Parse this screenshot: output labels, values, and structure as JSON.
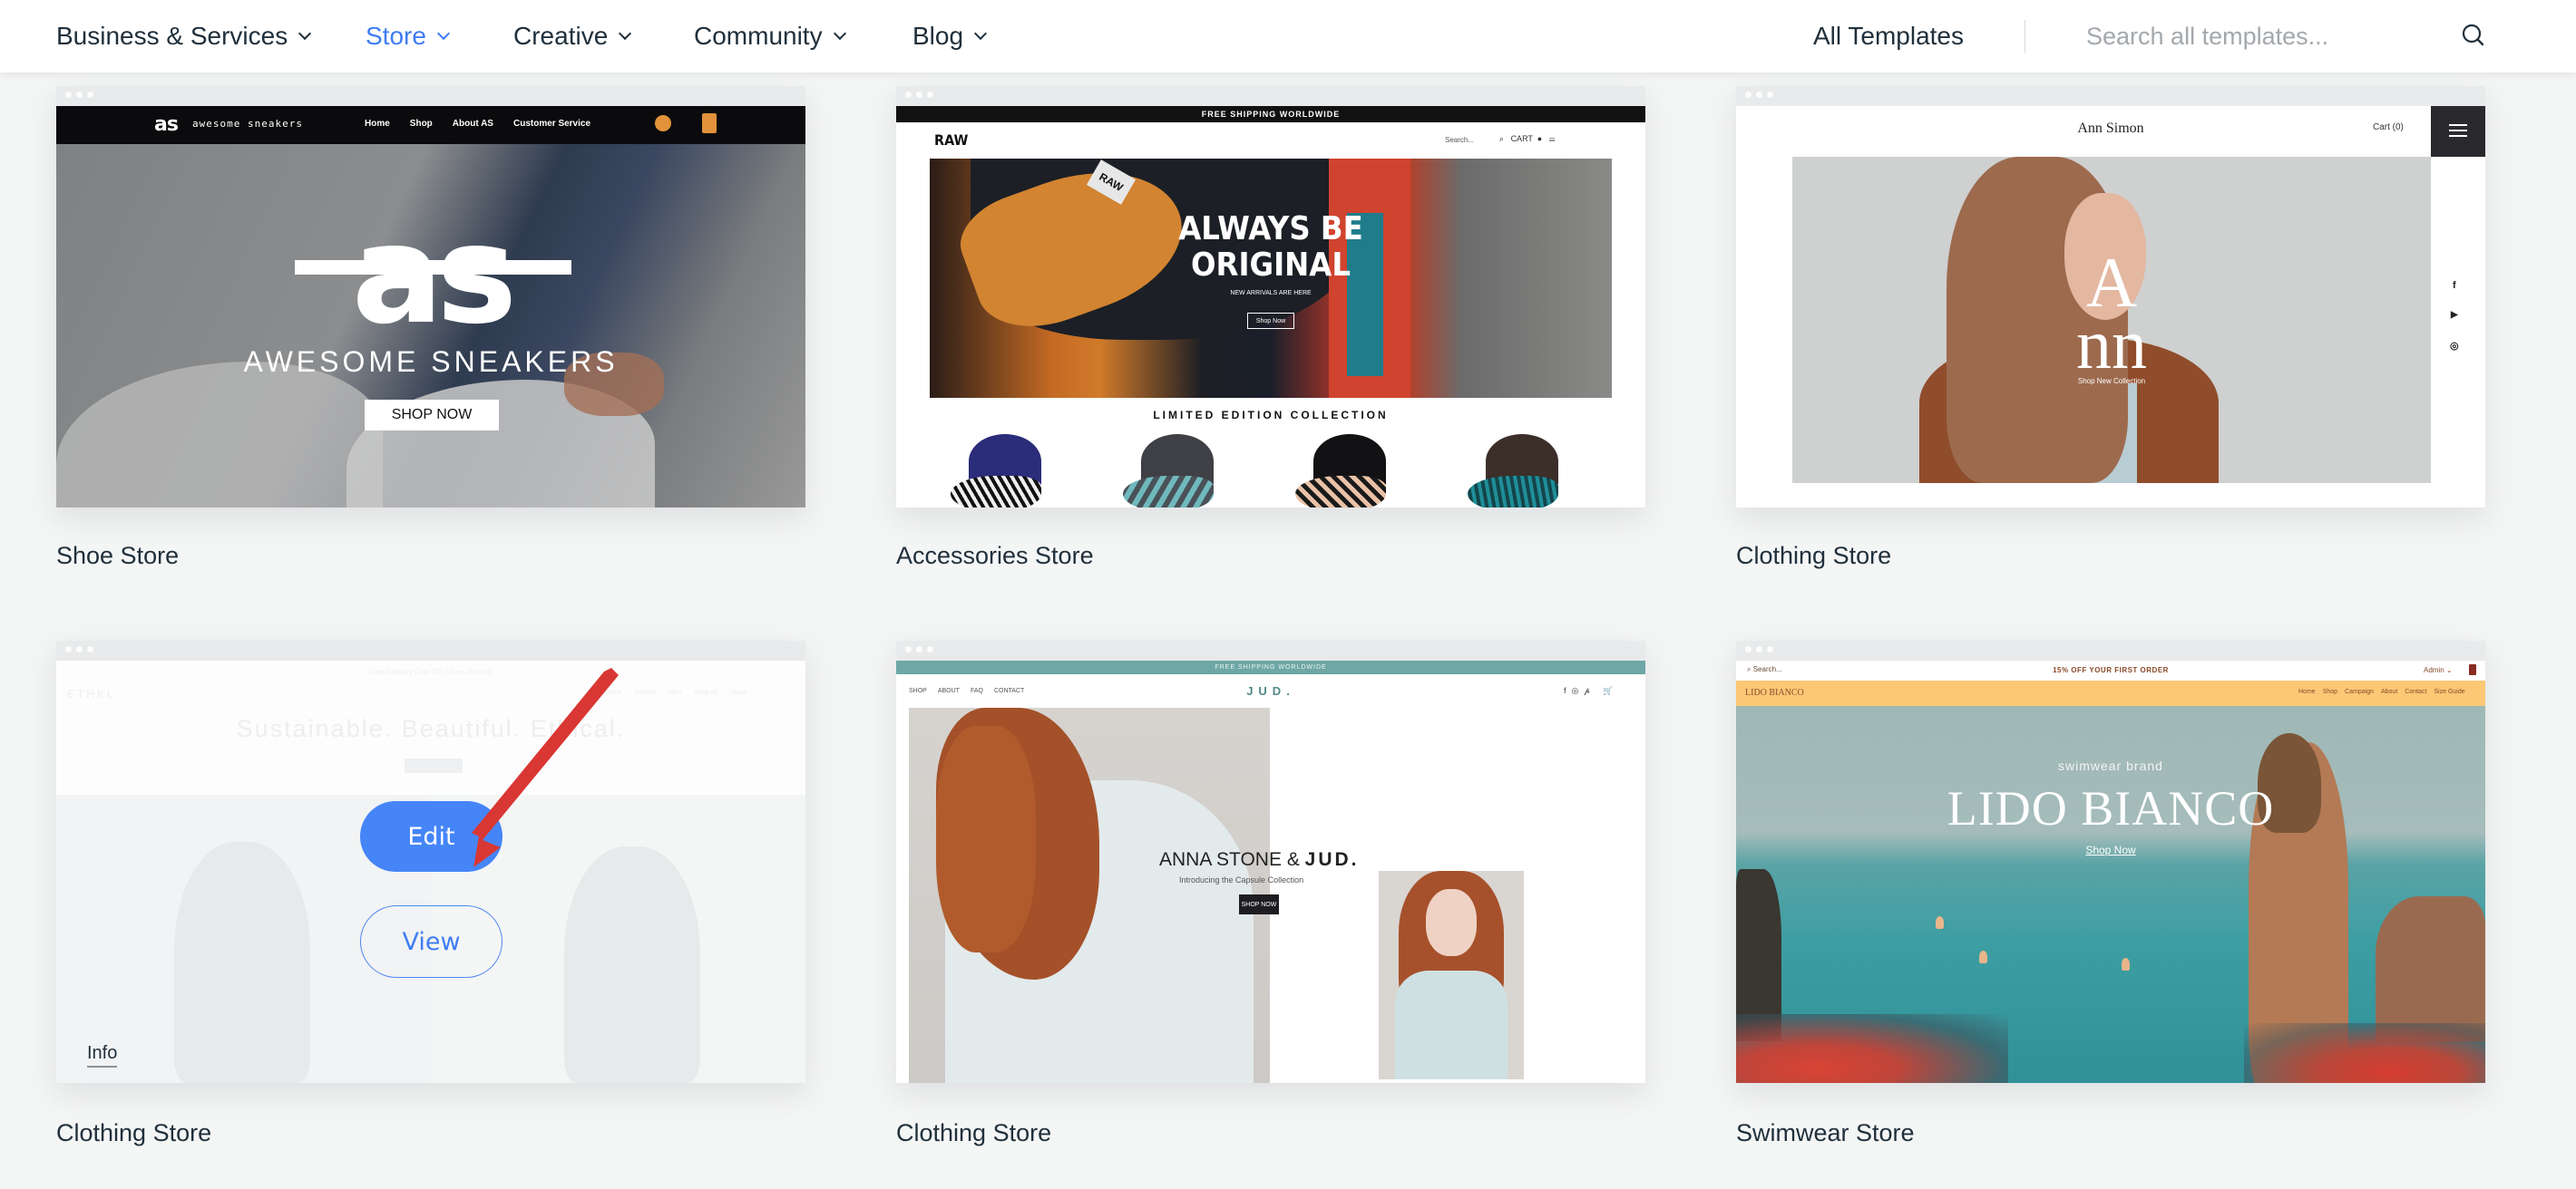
{
  "header": {
    "nav": [
      {
        "label": "Business & Services",
        "active": false
      },
      {
        "label": "Store",
        "active": true
      },
      {
        "label": "Creative",
        "active": false
      },
      {
        "label": "Community",
        "active": false
      },
      {
        "label": "Blog",
        "active": false
      }
    ],
    "all_templates_label": "All Templates",
    "search": {
      "placeholder": "Search all templates...",
      "value": ""
    },
    "accent_color": "#3f7cf4"
  },
  "templates": [
    {
      "label": "Shoe Store",
      "preview": {
        "logo": "as",
        "logo_text": "awesome sneakers",
        "nav": [
          "Home",
          "Shop",
          "About AS",
          "Customer Service"
        ],
        "hero_mark": "as",
        "hero_title": "AWESOME SNEAKERS",
        "cta": "SHOP NOW"
      }
    },
    {
      "label": "Accessories Store",
      "preview": {
        "announcement": "FREE SHIPPING WORLDWIDE",
        "logo": "RAW",
        "search": "Search...",
        "cart": "CART",
        "hero_title_line1": "ALWAYS BE",
        "hero_title_line2": "ORIGINAL",
        "hero_sub": "NEW ARRIVALS ARE HERE",
        "cta": "Shop Now",
        "section_title": "LIMITED EDITION COLLECTION",
        "cap_label": "RAW"
      }
    },
    {
      "label": "Clothing Store",
      "preview": {
        "brand": "Ann Simon",
        "cart": "Cart (0)",
        "hero_letter": "A",
        "hero_letters2": "nn",
        "cta": "Shop New Collection",
        "social": [
          "f",
          "▶",
          "◎"
        ]
      }
    },
    {
      "label": "Clothing Store",
      "hovered": true,
      "preview": {
        "announcement": "Free Delivery Over $75   |   Free Returns",
        "logo": "ETHKL",
        "nav": [
          "Home",
          "Women",
          "Men",
          "Shop All",
          "About"
        ],
        "headline": "Sustainable. Beautiful. Ethical."
      },
      "actions": {
        "edit": "Edit",
        "view": "View",
        "info": "Info"
      }
    },
    {
      "label": "Clothing Store",
      "preview": {
        "announcement": "FREE SHIPPING WORLDWIDE",
        "nav": [
          "SHOP",
          "ABOUT",
          "FAQ",
          "CONTACT"
        ],
        "logo": "JUD.",
        "headline_prefix": "ANNA STONE & ",
        "headline_brand": "JUD.",
        "intro": "Introducing the Capsule Collection",
        "cta": "SHOP NOW"
      }
    },
    {
      "label": "Swimwear Store",
      "preview": {
        "search": "Search...",
        "offer": "15% OFF YOUR FIRST ORDER",
        "account": "Admin",
        "logo": "LIDO BIANCO",
        "nav": [
          "Home",
          "Shop",
          "Campaign",
          "About",
          "Contact",
          "Size Guide"
        ],
        "brand_tag": "swimwear brand",
        "title": "LIDO BIANCO",
        "cta": "Shop Now"
      }
    }
  ]
}
